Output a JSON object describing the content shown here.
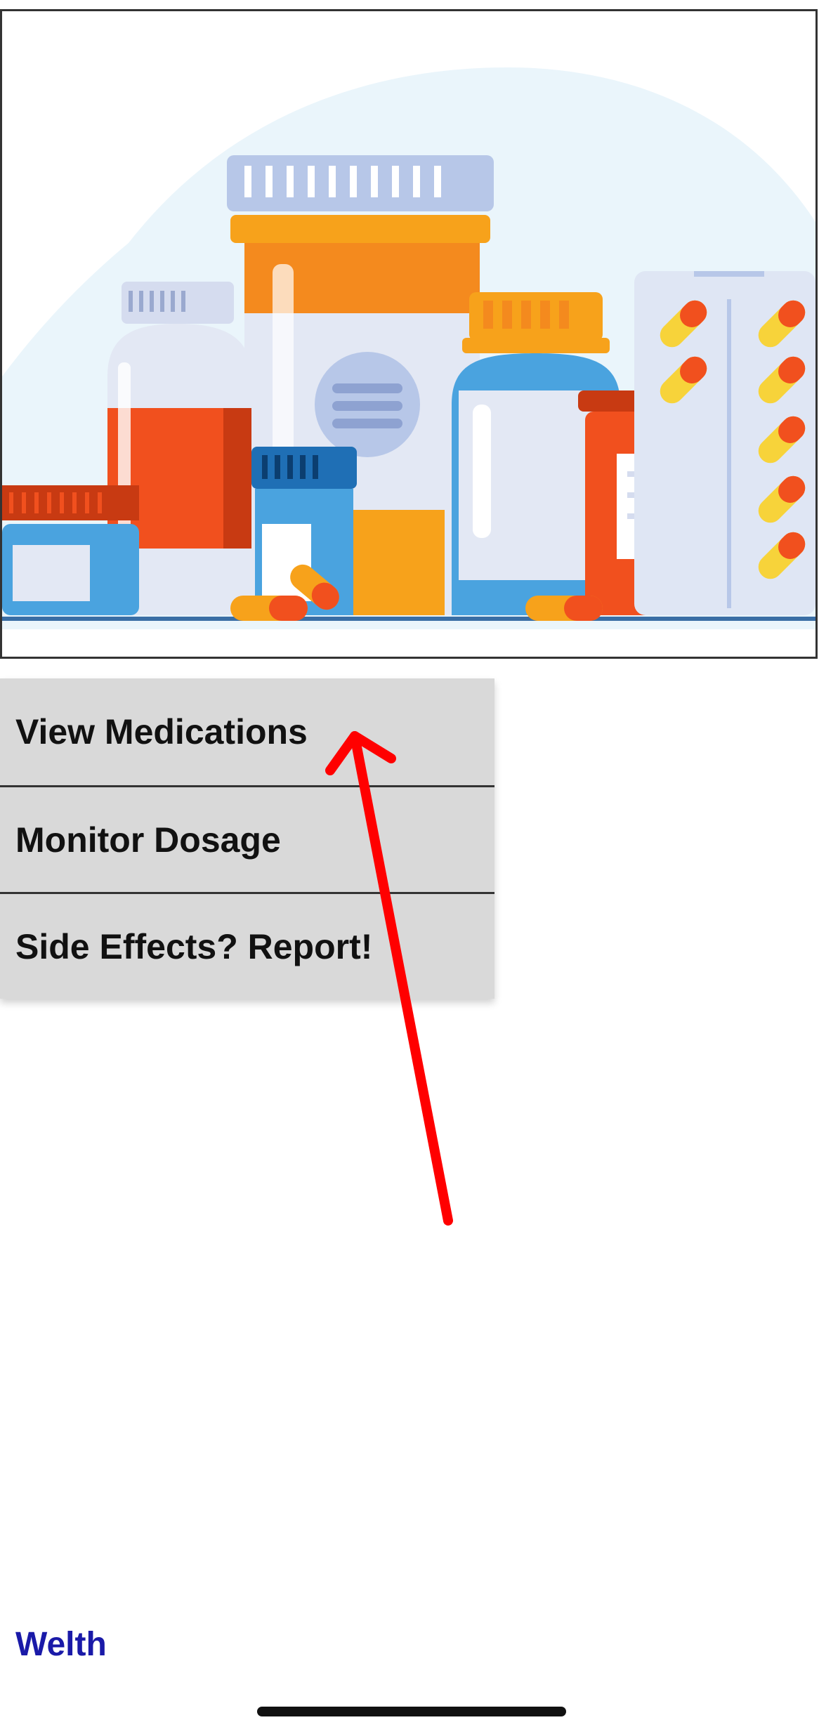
{
  "hero": {
    "image_icon": "medicine-bottles-illustration"
  },
  "menu": {
    "items": [
      {
        "label": "View Medications"
      },
      {
        "label": "Monitor Dosage"
      },
      {
        "label": "Side Effects? Report!"
      }
    ]
  },
  "annotation": {
    "icon": "red-arrow",
    "color": "#ff0000"
  },
  "footer": {
    "brand": "Welth",
    "brand_color": "#1a1aa8"
  },
  "colors": {
    "menu_bg": "#d9d9d9",
    "divider": "#333333"
  }
}
